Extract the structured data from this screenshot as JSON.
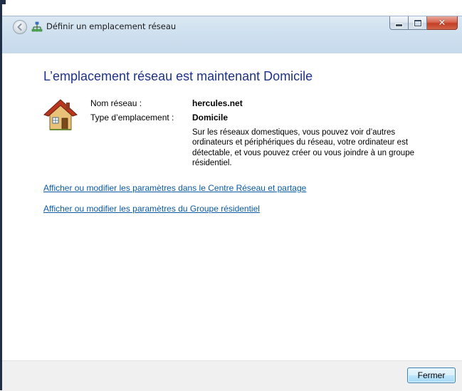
{
  "window": {
    "title": "Définir un emplacement réseau",
    "buttons": {
      "minimize": "minimize-icon",
      "maximize": "maximize-icon",
      "close": "close-icon",
      "close_glyph": "✕"
    }
  },
  "main": {
    "heading": "L’emplacement réseau est maintenant Domicile",
    "icon": "house-icon",
    "network_name_label": "Nom réseau :",
    "network_name_value": "hercules.net",
    "location_type_label": "Type d’emplacement :",
    "location_type_value": "Domicile",
    "description": "Sur les réseaux domestiques, vous pouvez voir d’autres ordinateurs et périphériques du réseau, votre ordinateur est détectable, et vous pouvez créer ou vous joindre à un groupe résidentiel."
  },
  "links": [
    {
      "label": "Afficher ou modifier les paramètres dans le Centre Réseau et partage"
    },
    {
      "label": "Afficher ou modifier les paramètres du Groupe résidentiel"
    }
  ],
  "footer": {
    "close_label": "Fermer"
  },
  "colors": {
    "heading": "#1e3287",
    "link": "#0b5ba7",
    "titlebar": "#cfe0ef",
    "footer": "#f0f0f0"
  }
}
